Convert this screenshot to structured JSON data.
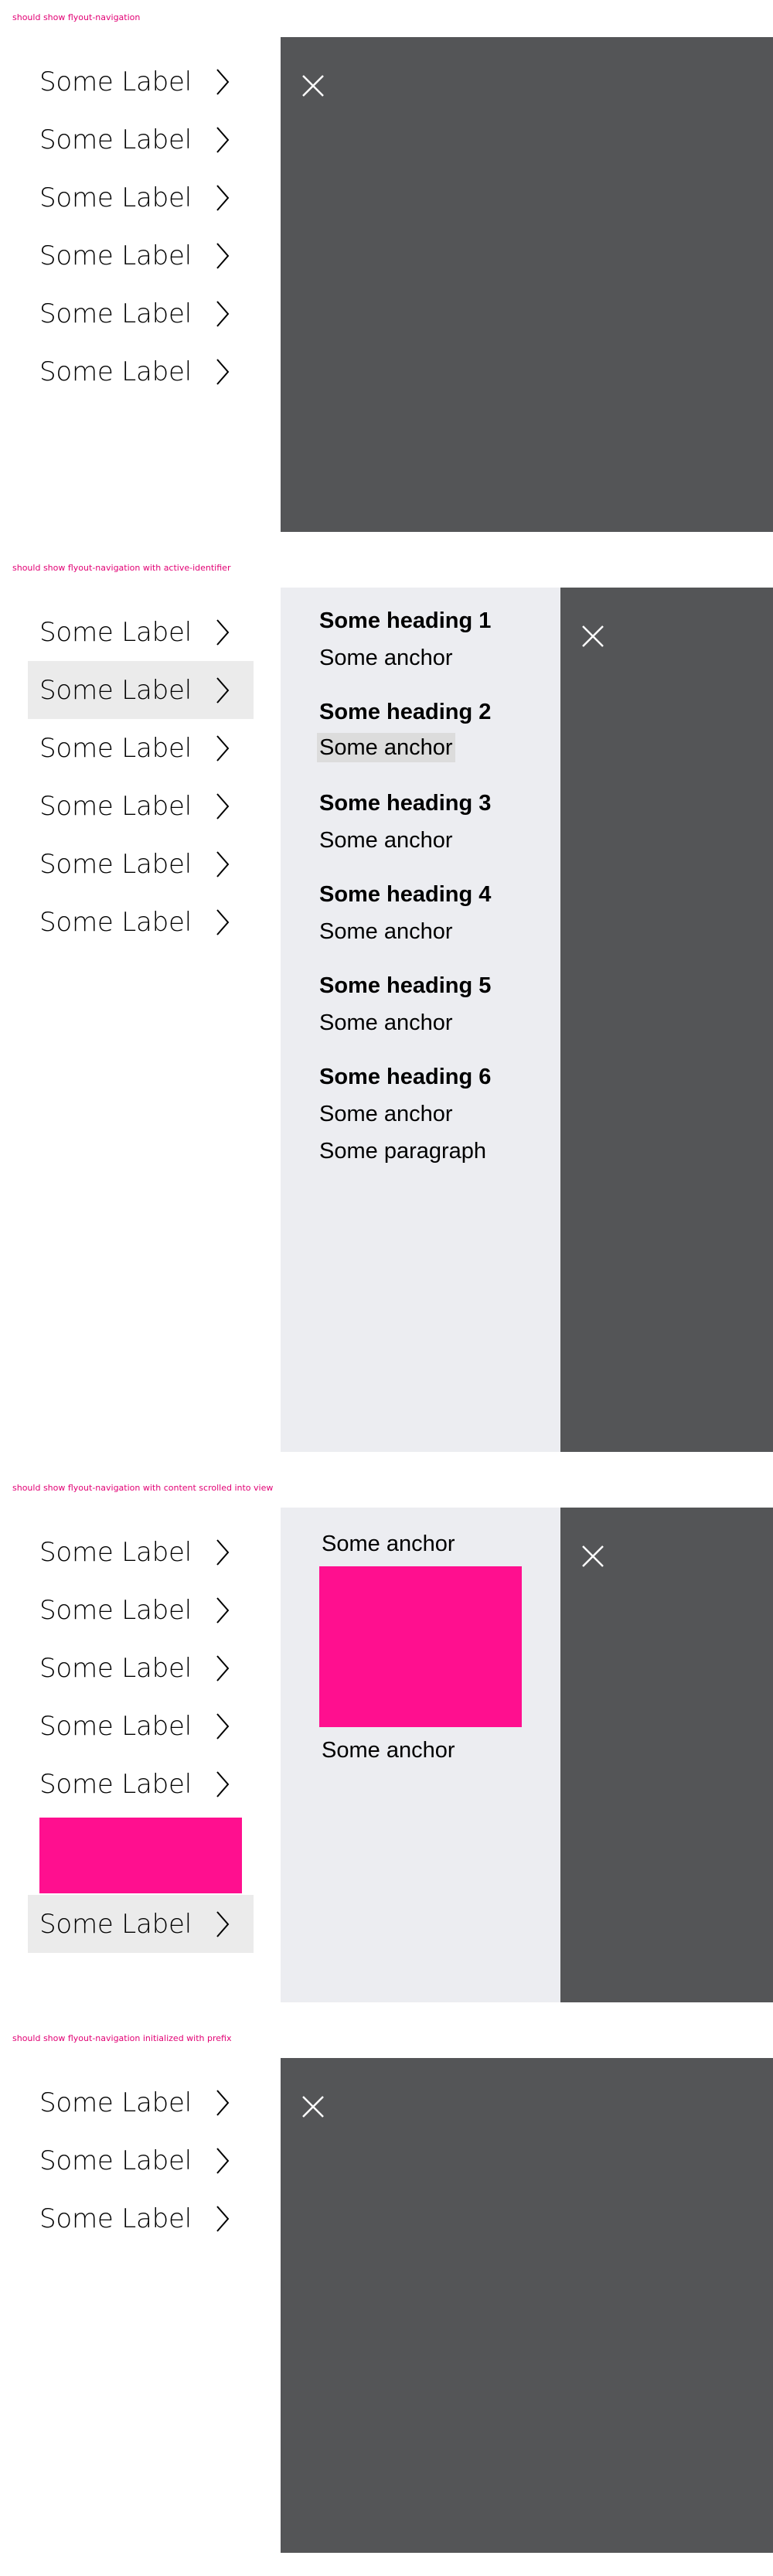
{
  "colors": {
    "magenta": "#ff0f8f",
    "caption": "#e20074",
    "flyout_dark": "#545557",
    "flyout_light": "#ecedf1",
    "active_item": "#ebebeb"
  },
  "sections": [
    {
      "caption": "should show flyout-navigation",
      "nav_items": [
        "Some Label",
        "Some Label",
        "Some Label",
        "Some Label",
        "Some Label",
        "Some Label"
      ]
    },
    {
      "caption": "should show flyout-navigation with active-identifier",
      "nav_items": [
        "Some Label",
        "Some Label",
        "Some Label",
        "Some Label",
        "Some Label",
        "Some Label"
      ],
      "groups": [
        {
          "heading": "Some heading 1",
          "anchor": "Some anchor"
        },
        {
          "heading": "Some heading 2",
          "anchor": "Some anchor"
        },
        {
          "heading": "Some heading 3",
          "anchor": "Some anchor"
        },
        {
          "heading": "Some heading 4",
          "anchor": "Some anchor"
        },
        {
          "heading": "Some heading 5",
          "anchor": "Some anchor"
        },
        {
          "heading": "Some heading 6",
          "anchor": "Some anchor"
        }
      ],
      "paragraph": "Some paragraph"
    },
    {
      "caption": "should show flyout-navigation with content scrolled into view",
      "nav_items": [
        "Some Label",
        "Some Label",
        "Some Label",
        "Some Label",
        "Some Label",
        "Some Label"
      ],
      "anchors": [
        "Some anchor",
        "Some anchor"
      ]
    },
    {
      "caption": "should show flyout-navigation initialized with prefix",
      "nav_items": [
        "Some Label",
        "Some Label",
        "Some Label"
      ]
    }
  ],
  "icons": {
    "close": "close-icon",
    "chevron": "chevron-right-icon"
  }
}
